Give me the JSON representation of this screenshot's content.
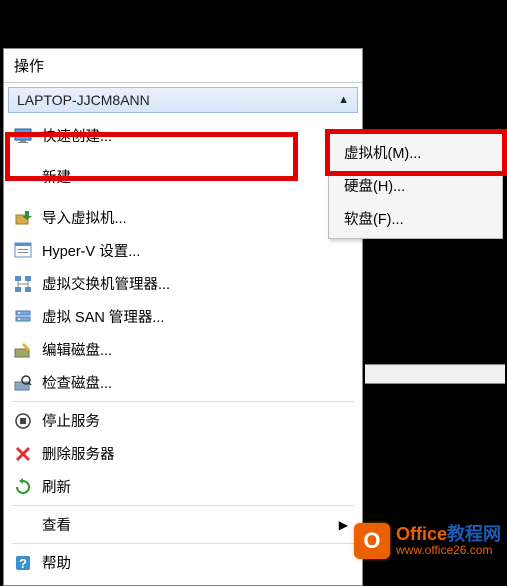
{
  "panel": {
    "header": "操作",
    "section": "LAPTOP-JJCM8ANN"
  },
  "menu": {
    "quick_create": "快速创建...",
    "new": "新建",
    "import_vm": "导入虚拟机...",
    "hyperv_settings": "Hyper-V 设置...",
    "vswitch_mgr": "虚拟交换机管理器...",
    "vsan_mgr": "虚拟 SAN 管理器...",
    "edit_disk": "编辑磁盘...",
    "inspect_disk": "检查磁盘...",
    "stop_service": "停止服务",
    "remove_server": "删除服务器",
    "refresh": "刷新",
    "view": "查看",
    "help": "帮助"
  },
  "submenu": {
    "vm": "虚拟机(M)...",
    "hdd": "硬盘(H)...",
    "floppy": "软盘(F)..."
  },
  "watermark": {
    "brand1": "Office",
    "brand2": "教程网",
    "url": "www.office26.com"
  }
}
